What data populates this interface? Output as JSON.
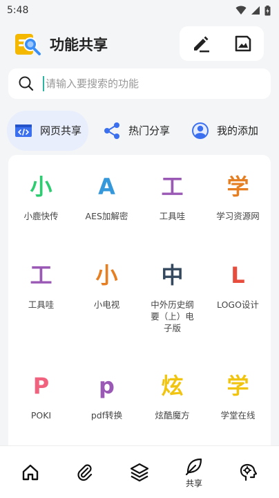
{
  "status": {
    "time": "5:48"
  },
  "header": {
    "title": "功能共享"
  },
  "search": {
    "placeholder": "请输入要搜索的功能"
  },
  "tabs": [
    {
      "label": "网页共享",
      "icon": "browser-code-icon",
      "active": true
    },
    {
      "label": "热门分享",
      "icon": "share-icon",
      "active": false
    },
    {
      "label": "我的添加",
      "icon": "user-circle-icon",
      "active": false
    }
  ],
  "grid": [
    {
      "char": "小",
      "label": "小鹿快传",
      "color": "#2ecc71"
    },
    {
      "char": "A",
      "label": "AES加解密",
      "color": "#3498db"
    },
    {
      "char": "工",
      "label": "工具哇",
      "color": "#9b59b6"
    },
    {
      "char": "学",
      "label": "学习资源网",
      "color": "#e67e22"
    },
    {
      "char": "工",
      "label": "工具哇",
      "color": "#9b59b6"
    },
    {
      "char": "小",
      "label": "小电视",
      "color": "#e67e22"
    },
    {
      "char": "中",
      "label": "中外历史纲要（上）电子版",
      "color": "#34495e"
    },
    {
      "char": "L",
      "label": "LOGO设计",
      "color": "#e74c3c"
    },
    {
      "char": "P",
      "label": "POKI",
      "color": "#f0627e"
    },
    {
      "char": "p",
      "label": "pdf转换",
      "color": "#9b59b6"
    },
    {
      "char": "炫",
      "label": "炫酷魔方",
      "color": "#f1c40f"
    },
    {
      "char": "学",
      "label": "学堂在线",
      "color": "#f1c40f"
    }
  ],
  "nav": [
    {
      "icon": "home-icon",
      "label": ""
    },
    {
      "icon": "paperclip-icon",
      "label": ""
    },
    {
      "icon": "layers-icon",
      "label": ""
    },
    {
      "icon": "leaf-icon",
      "label": "共享",
      "active": true
    },
    {
      "icon": "brain-icon",
      "label": ""
    }
  ]
}
